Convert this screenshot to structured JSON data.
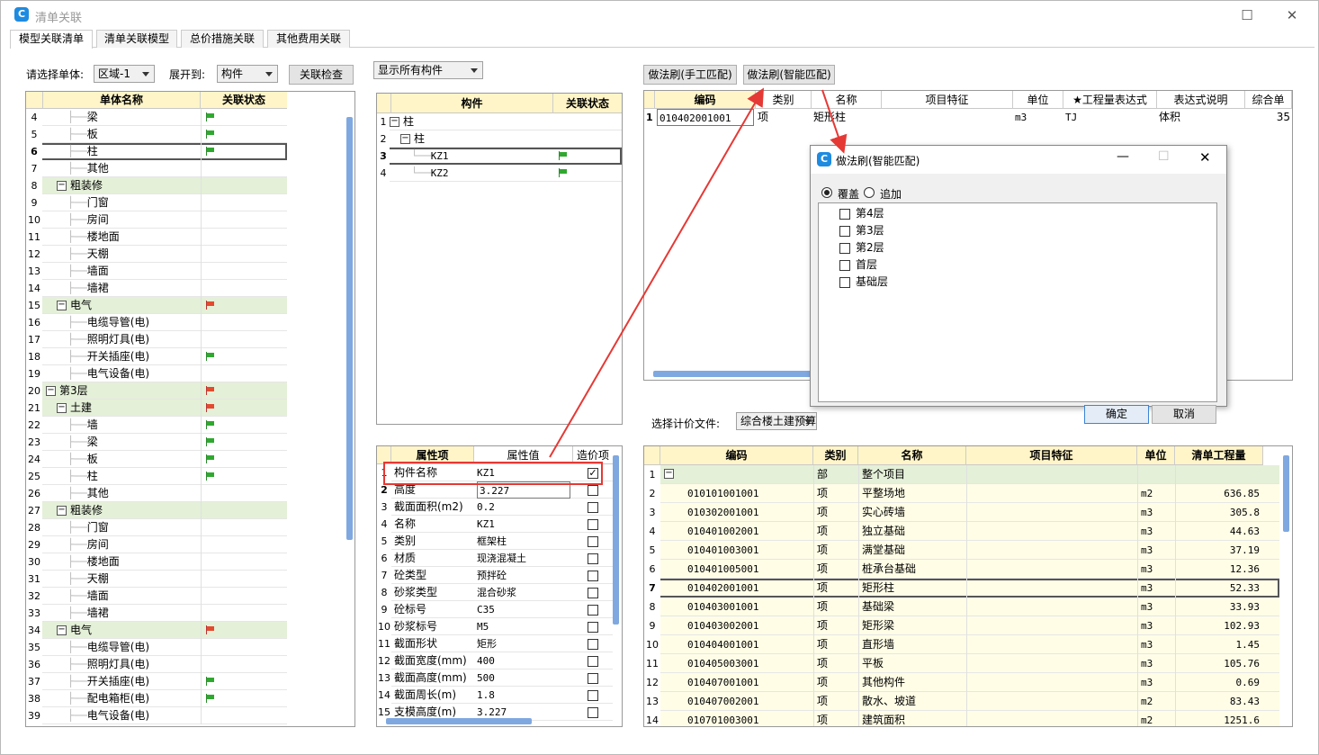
{
  "window": {
    "title": "清单关联"
  },
  "tabs": [
    "模型关联清单",
    "清单关联模型",
    "总价措施关联",
    "其他费用关联"
  ],
  "left": {
    "select_unit_label": "请选择单体:",
    "unit_value": "区域-1",
    "expand_label": "展开到:",
    "expand_value": "构件",
    "check_button": "关联检查",
    "col_name": "单体名称",
    "col_status": "关联状态",
    "rows": [
      {
        "n": "4",
        "label": "梁",
        "lvl": 2,
        "flag": "green"
      },
      {
        "n": "5",
        "label": "板",
        "lvl": 2,
        "flag": "green"
      },
      {
        "n": "6",
        "label": "柱",
        "lvl": 2,
        "flag": "green",
        "sel": true
      },
      {
        "n": "7",
        "label": "其他",
        "lvl": 2,
        "flag": ""
      },
      {
        "n": "8",
        "label": "粗装修",
        "lvl": 1,
        "flag": "",
        "grp": true
      },
      {
        "n": "9",
        "label": "门窗",
        "lvl": 2,
        "flag": ""
      },
      {
        "n": "10",
        "label": "房间",
        "lvl": 2,
        "flag": ""
      },
      {
        "n": "11",
        "label": "楼地面",
        "lvl": 2,
        "flag": ""
      },
      {
        "n": "12",
        "label": "天棚",
        "lvl": 2,
        "flag": ""
      },
      {
        "n": "13",
        "label": "墙面",
        "lvl": 2,
        "flag": ""
      },
      {
        "n": "14",
        "label": "墙裙",
        "lvl": 2,
        "flag": ""
      },
      {
        "n": "15",
        "label": "电气",
        "lvl": 1,
        "flag": "red",
        "grp": true
      },
      {
        "n": "16",
        "label": "电缆导管(电)",
        "lvl": 2,
        "flag": ""
      },
      {
        "n": "17",
        "label": "照明灯具(电)",
        "lvl": 2,
        "flag": ""
      },
      {
        "n": "18",
        "label": "开关插座(电)",
        "lvl": 2,
        "flag": "green"
      },
      {
        "n": "19",
        "label": "电气设备(电)",
        "lvl": 2,
        "flag": ""
      },
      {
        "n": "20",
        "label": "第3层",
        "lvl": 0,
        "flag": "red",
        "grp": true
      },
      {
        "n": "21",
        "label": "土建",
        "lvl": 1,
        "flag": "red",
        "grp": true
      },
      {
        "n": "22",
        "label": "墙",
        "lvl": 2,
        "flag": "green"
      },
      {
        "n": "23",
        "label": "梁",
        "lvl": 2,
        "flag": "green"
      },
      {
        "n": "24",
        "label": "板",
        "lvl": 2,
        "flag": "green"
      },
      {
        "n": "25",
        "label": "柱",
        "lvl": 2,
        "flag": "green"
      },
      {
        "n": "26",
        "label": "其他",
        "lvl": 2,
        "flag": ""
      },
      {
        "n": "27",
        "label": "粗装修",
        "lvl": 1,
        "flag": "",
        "grp": true
      },
      {
        "n": "28",
        "label": "门窗",
        "lvl": 2,
        "flag": ""
      },
      {
        "n": "29",
        "label": "房间",
        "lvl": 2,
        "flag": ""
      },
      {
        "n": "30",
        "label": "楼地面",
        "lvl": 2,
        "flag": ""
      },
      {
        "n": "31",
        "label": "天棚",
        "lvl": 2,
        "flag": ""
      },
      {
        "n": "32",
        "label": "墙面",
        "lvl": 2,
        "flag": ""
      },
      {
        "n": "33",
        "label": "墙裙",
        "lvl": 2,
        "flag": ""
      },
      {
        "n": "34",
        "label": "电气",
        "lvl": 1,
        "flag": "red",
        "grp": true
      },
      {
        "n": "35",
        "label": "电缆导管(电)",
        "lvl": 2,
        "flag": ""
      },
      {
        "n": "36",
        "label": "照明灯具(电)",
        "lvl": 2,
        "flag": ""
      },
      {
        "n": "37",
        "label": "开关插座(电)",
        "lvl": 2,
        "flag": "green"
      },
      {
        "n": "38",
        "label": "配电箱柜(电)",
        "lvl": 2,
        "flag": "green"
      },
      {
        "n": "39",
        "label": "电气设备(电)",
        "lvl": 2,
        "flag": ""
      }
    ]
  },
  "middle": {
    "filter_value": "显示所有构件",
    "col_comp": "构件",
    "col_status": "关联状态",
    "rows": [
      {
        "n": "1",
        "label": "柱",
        "lvl": 0,
        "flag": ""
      },
      {
        "n": "2",
        "label": "柱",
        "lvl": 1,
        "flag": ""
      },
      {
        "n": "3",
        "label": "KZ1",
        "lvl": 2,
        "flag": "green",
        "sel": true
      },
      {
        "n": "4",
        "label": "KZ2",
        "lvl": 2,
        "flag": "green"
      }
    ],
    "prop_col_item": "属性项",
    "prop_col_value": "属性值",
    "prop_col_cost": "造价项",
    "props": [
      {
        "n": "1",
        "item": "构件名称",
        "value": "KZ1",
        "checked": true
      },
      {
        "n": "2",
        "item": "高度",
        "value": "3.227"
      },
      {
        "n": "3",
        "item": "截面面积(m2)",
        "value": "0.2"
      },
      {
        "n": "4",
        "item": "名称",
        "value": "KZ1"
      },
      {
        "n": "5",
        "item": "类别",
        "value": "框架柱"
      },
      {
        "n": "6",
        "item": "材质",
        "value": "现浇混凝土"
      },
      {
        "n": "7",
        "item": "砼类型",
        "value": "预拌砼"
      },
      {
        "n": "8",
        "item": "砂浆类型",
        "value": "混合砂浆"
      },
      {
        "n": "9",
        "item": "砼标号",
        "value": "C35"
      },
      {
        "n": "10",
        "item": "砂浆标号",
        "value": "M5"
      },
      {
        "n": "11",
        "item": "截面形状",
        "value": "矩形"
      },
      {
        "n": "12",
        "item": "截面宽度(mm)",
        "value": "400"
      },
      {
        "n": "13",
        "item": "截面高度(mm)",
        "value": "500"
      },
      {
        "n": "14",
        "item": "截面周长(m)",
        "value": "1.8"
      },
      {
        "n": "15",
        "item": "支模高度(m)",
        "value": "3.227"
      }
    ]
  },
  "right_top": {
    "manual_button": "做法刷(手工匹配)",
    "smart_button": "做法刷(智能匹配)",
    "cols": [
      "编码",
      "类别",
      "名称",
      "项目特征",
      "单位",
      "★工程量表达式",
      "表达式说明",
      "综合单"
    ],
    "row": {
      "n": "1",
      "code": "010402001001",
      "type": "项",
      "name": "矩形柱",
      "feature": "",
      "unit": "m3",
      "expr": "TJ",
      "desc": "体积",
      "price": "35"
    }
  },
  "right_bottom": {
    "select_label": "选择计价文件:",
    "file_value": "综合楼土建预算",
    "cols": [
      "编码",
      "类别",
      "名称",
      "项目特征",
      "单位",
      "清单工程量"
    ],
    "rows": [
      {
        "n": "1",
        "code": "",
        "type": "部",
        "name": "整个项目",
        "unit": "",
        "qty": "",
        "grp": true
      },
      {
        "n": "2",
        "code": "010101001001",
        "type": "项",
        "name": "平整场地",
        "unit": "m2",
        "qty": "636.85"
      },
      {
        "n": "3",
        "code": "010302001001",
        "type": "项",
        "name": "实心砖墙",
        "unit": "m3",
        "qty": "305.8"
      },
      {
        "n": "4",
        "code": "010401002001",
        "type": "项",
        "name": "独立基础",
        "unit": "m3",
        "qty": "44.63"
      },
      {
        "n": "5",
        "code": "010401003001",
        "type": "项",
        "name": "满堂基础",
        "unit": "m3",
        "qty": "37.19"
      },
      {
        "n": "6",
        "code": "010401005001",
        "type": "项",
        "name": "桩承台基础",
        "unit": "m3",
        "qty": "12.36"
      },
      {
        "n": "7",
        "code": "010402001001",
        "type": "项",
        "name": "矩形柱",
        "unit": "m3",
        "qty": "52.33",
        "sel": true
      },
      {
        "n": "8",
        "code": "010403001001",
        "type": "项",
        "name": "基础梁",
        "unit": "m3",
        "qty": "33.93"
      },
      {
        "n": "9",
        "code": "010403002001",
        "type": "项",
        "name": "矩形梁",
        "unit": "m3",
        "qty": "102.93"
      },
      {
        "n": "10",
        "code": "010404001001",
        "type": "项",
        "name": "直形墙",
        "unit": "m3",
        "qty": "1.45"
      },
      {
        "n": "11",
        "code": "010405003001",
        "type": "项",
        "name": "平板",
        "unit": "m3",
        "qty": "105.76"
      },
      {
        "n": "12",
        "code": "010407001001",
        "type": "项",
        "name": "其他构件",
        "unit": "m3",
        "qty": "0.69"
      },
      {
        "n": "13",
        "code": "010407002001",
        "type": "项",
        "name": "散水、坡道",
        "unit": "m2",
        "qty": "83.43"
      },
      {
        "n": "14",
        "code": "010701003001",
        "type": "项",
        "name": "建筑面积",
        "unit": "m2",
        "qty": "1251.6"
      }
    ]
  },
  "dialog": {
    "title": "做法刷(智能匹配)",
    "radio_cover": "覆盖",
    "radio_add": "追加",
    "floors": [
      "第4层",
      "第3层",
      "第2层",
      "首层",
      "基础层"
    ],
    "ok": "确定",
    "cancel": "取消"
  },
  "colors": {
    "header": "#fff5c8",
    "group": "#e4f0d8",
    "annotation": "#e53935",
    "scroll": "#7fa8e0"
  }
}
